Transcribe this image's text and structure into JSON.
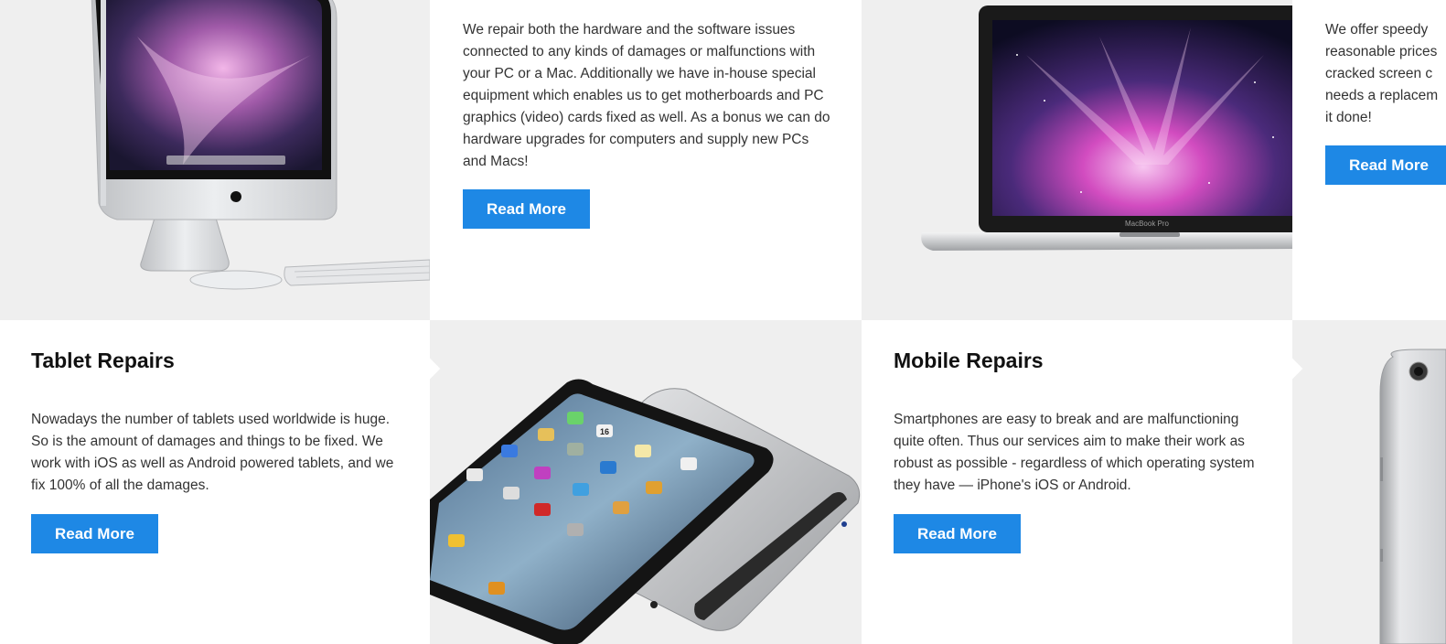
{
  "row1": {
    "pc": {
      "text": "We repair both the hardware and the software issues connected to any kinds of damages or malfunctions with your PC or a Mac. Additionally we have in-house special equipment which enables us to get motherboards and PC graphics (video) cards fixed as well. As a bonus we can do hardware upgrades for computers and supply new PCs and Macs!",
      "button": "Read More"
    },
    "laptop": {
      "text": "We offer speedy reasonable prices cracked screen c needs a replacem it done!",
      "button": "Read More",
      "brand_label": "MacBook Pro"
    }
  },
  "row2": {
    "tablet": {
      "title": "Tablet Repairs",
      "text": "Nowadays the number of tablets used worldwide is huge. So is the amount of damages and things to be fixed. We work with iOS as well as Android powered tablets, and we fix 100% of all the damages.",
      "button": "Read More",
      "clock_label": "16"
    },
    "mobile": {
      "title": "Mobile Repairs",
      "text": "Smartphones are easy to break and are malfunctioning quite often. Thus our services aim to make their work as robust as possible - regardless of which operating system they have — iPhone's iOS or Android.",
      "button": "Read More"
    }
  },
  "colors": {
    "accent": "#1e88e5",
    "grey_panel": "#efefef"
  }
}
